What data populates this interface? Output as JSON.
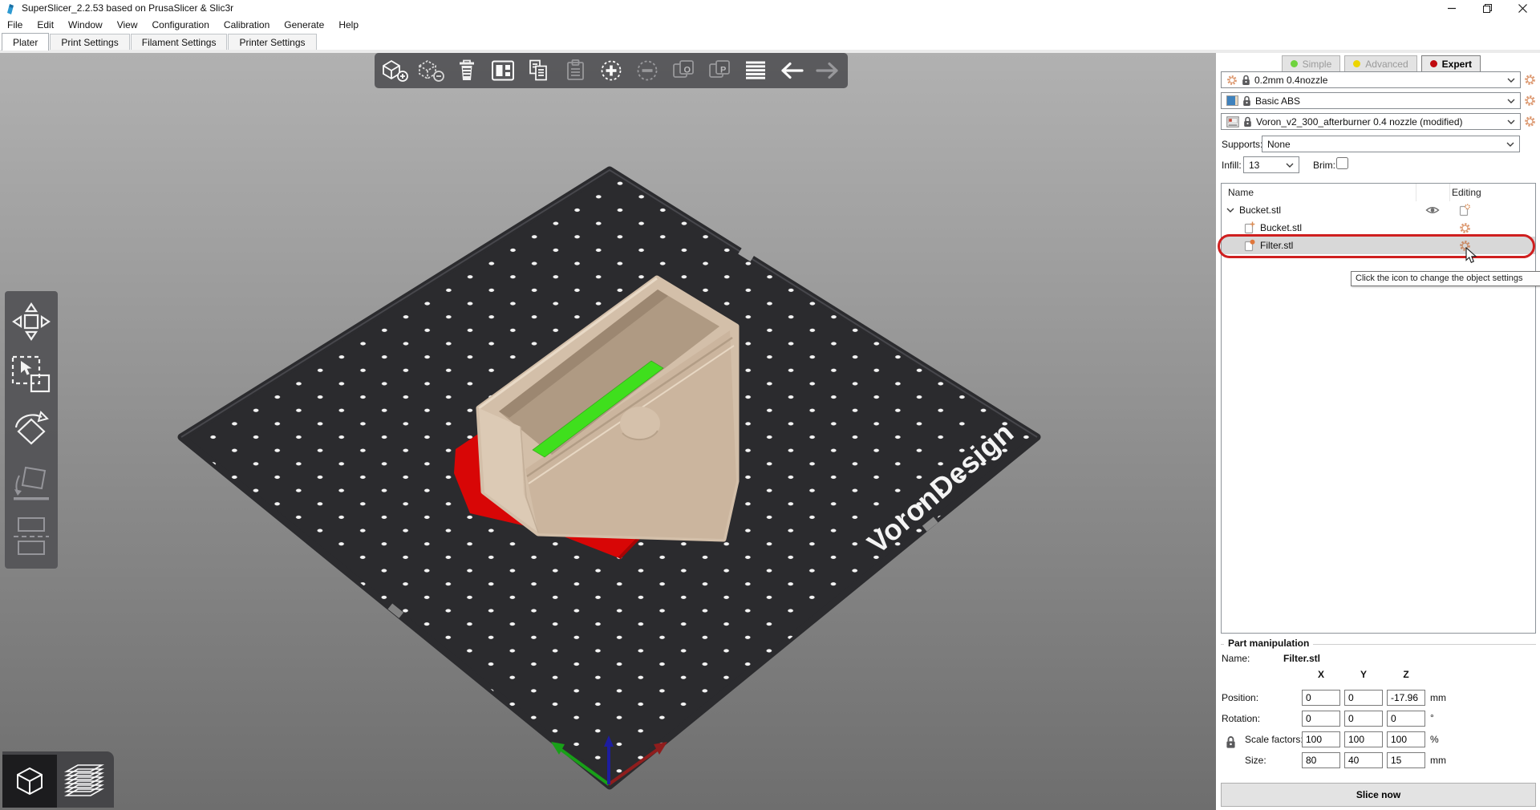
{
  "window": {
    "title": "SuperSlicer_2.2.53 based on PrusaSlicer & Slic3r"
  },
  "menu": {
    "items": [
      "File",
      "Edit",
      "Window",
      "View",
      "Configuration",
      "Calibration",
      "Generate",
      "Help"
    ]
  },
  "tabs": {
    "items": [
      "Plater",
      "Print Settings",
      "Filament Settings",
      "Printer Settings"
    ],
    "active": "Plater"
  },
  "toolbar_top": {
    "buttons": [
      "add-object",
      "delete-object",
      "delete-all",
      "arrange",
      "copy",
      "paste",
      "add-instance",
      "remove-instance",
      "split-to-objects",
      "split-to-parts",
      "layer-height-editing",
      "undo",
      "redo"
    ]
  },
  "gizmo_bar": {
    "buttons": [
      "move",
      "scale",
      "rotate",
      "place-on-face",
      "cut"
    ]
  },
  "view_toggle": {
    "buttons": [
      "3d-view",
      "preview-layers"
    ],
    "active": "3d-view"
  },
  "viewport": {
    "bed_logo": "VoronDesign"
  },
  "right_panel": {
    "modes": {
      "simple": "Simple",
      "advanced": "Advanced",
      "expert": "Expert",
      "active": "Expert"
    },
    "print_profile": "0.2mm 0.4nozzle",
    "filament_profile": "Basic ABS",
    "printer_profile": "Voron_v2_300_afterburner 0.4 nozzle (modified)",
    "supports_label": "Supports:",
    "supports_value": "None",
    "infill_label": "Infill:",
    "infill_value": "13",
    "brim_label": "Brim:",
    "list": {
      "header_name": "Name",
      "header_editing": "Editing",
      "rows": [
        {
          "name": "Bucket.stl"
        },
        {
          "name": "Bucket.stl"
        },
        {
          "name": "Filter.stl"
        }
      ]
    },
    "tooltip": "Click the icon to change the object settings",
    "part": {
      "title": "Part manipulation",
      "name_label": "Name:",
      "name_value": "Filter.stl",
      "ax": "X",
      "ay": "Y",
      "az": "Z",
      "rows": [
        {
          "label": "Position:",
          "x": "0",
          "y": "0",
          "z": "-17.96",
          "unit": "mm"
        },
        {
          "label": "Rotation:",
          "x": "0",
          "y": "0",
          "z": "0",
          "unit": "°"
        },
        {
          "label": "Scale factors:",
          "x": "100",
          "y": "100",
          "z": "100",
          "unit": "%"
        },
        {
          "label": "Size:",
          "x": "80",
          "y": "40",
          "z": "15",
          "unit": "mm"
        }
      ]
    },
    "slice_button": "Slice now"
  },
  "icons": {
    "app-logo-icon": "superslicer-mark",
    "minimize-icon": "line",
    "restore-icon": "two-squares",
    "close-icon": "x",
    "gear-icon": "gear",
    "lock-icon": "padlock",
    "eye-icon": "eye",
    "chevron-down-icon": "v",
    "printer-icon": "printer",
    "filament-swatch-icon": "color-square",
    "cursor-icon": "arrow-pointer"
  },
  "colors": {
    "bed": "#2b2b2e",
    "selection_green": "#3fdf1d",
    "error_red": "#d80606",
    "filament_blue": "#3f82bd",
    "mode_simple": "#6fd33e",
    "mode_advanced": "#edd500",
    "mode_expert": "#c00a10",
    "annotation_red": "#cf1f1f",
    "gear_orange": "#dd9a72"
  }
}
